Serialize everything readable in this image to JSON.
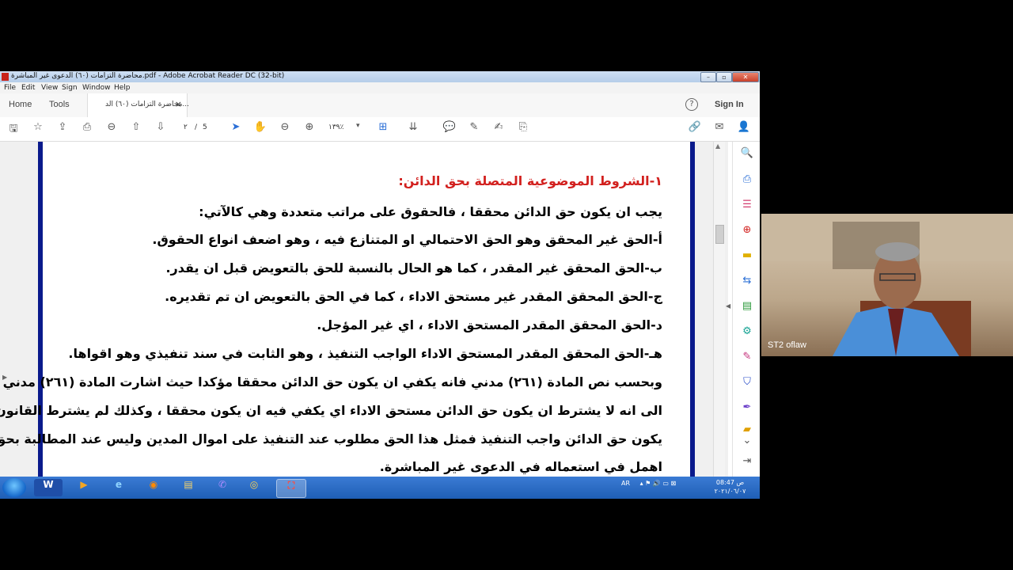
{
  "window": {
    "title": "محاضرة التزامات (٦٠) الدعوى غير المباشرة.pdf - Adobe Acrobat Reader DC (32-bit)"
  },
  "menu": [
    "File",
    "Edit",
    "View",
    "Sign",
    "Window",
    "Help"
  ],
  "tabs": {
    "home": "Home",
    "tools": "Tools",
    "doc_tab": "محاضرة التزامات (٦٠) الد...",
    "close": "×",
    "help": "?",
    "sign_in": "Sign In"
  },
  "toolbar": {
    "page_current": "٢",
    "page_sep": "/",
    "page_total": "5",
    "zoom": "١٣٩٪"
  },
  "document": {
    "heading": "١-الشروط الموضوعية المتصلة بحق الدائن:",
    "lines": [
      "يجب ان يكون حق الدائن محققا ، فالحقوق على مراتب متعددة وهي كالآتي:",
      "أ-الحق غير المحقق وهو الحق الاحتمالي او المتنازع فيه ، وهو اضعف انواع الحقوق.",
      "ب-الحق المحقق غير المقدر ، كما هو الحال بالنسبة للحق بالتعويض قبل ان يقدر.",
      "ج-الحق المحقق المقدر غير مستحق الاداء ، كما في الحق بالتعويض ان تم تقديره.",
      "د-الحق المحقق المقدر المستحق الاداء ، اي غير المؤجل.",
      "هـ-الحق المحقق المقدر المستحق الاداء الواجب التنفيذ ، وهو الثابت في سند تنفيذي وهو اقواها.",
      "وبحسب نص المادة (٢٦١) مدني فانه يكفي ان يكون حق الدائن محققا مؤكدا حيث اشارت المادة (٢٦١) مدني",
      "الى انه لا يشترط ان يكون حق الدائن مستحق الاداء اي يكفي فيه ان يكون محققا ، وكذلك لم يشترط القانون ان",
      "يكون حق الدائن واجب التنفيذ فمثل هذا الحق مطلوب عند التنفيذ على اموال المدين وليس عند المطالبة بحق",
      "اهمل في استعماله في الدعوى غير المباشرة."
    ]
  },
  "taskbar": {
    "apps": [
      "W",
      "▶",
      "e",
      "◉",
      "▤",
      "✆",
      "◎",
      "⛶"
    ],
    "lang": "AR",
    "time": "08:47 ص",
    "date": "٢٠٢١/٠٦/٠٧"
  },
  "webcam": {
    "name": "ST2 oflaw"
  },
  "colors": {
    "heading_red": "#d2201e",
    "page_border": "#0a1a8c",
    "taskbar": "#1f5fb5",
    "acrobat_red": "#c8231b"
  }
}
